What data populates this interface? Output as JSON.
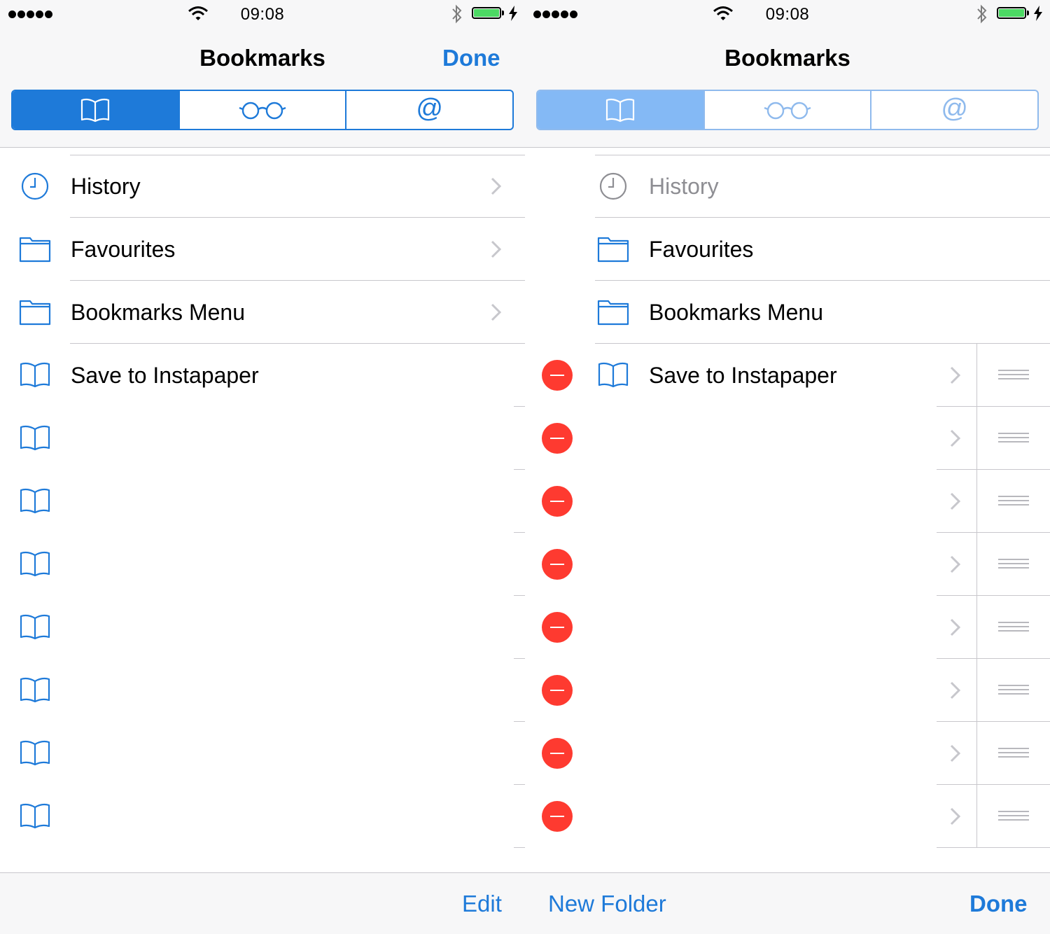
{
  "colors": {
    "accent": "#1e7ad9",
    "delete": "#fe3a30",
    "battery": "#4cd964",
    "separator": "#c8c7cc"
  },
  "left": {
    "status": {
      "time": "09:08"
    },
    "nav": {
      "title": "Bookmarks",
      "done_label": "Done"
    },
    "segments": [
      {
        "icon": "book-icon",
        "selected": true
      },
      {
        "icon": "glasses-icon",
        "selected": false
      },
      {
        "icon": "at-icon",
        "text": "@",
        "selected": false
      }
    ],
    "rows": [
      {
        "icon": "clock-icon",
        "label": "History",
        "chevron": true
      },
      {
        "icon": "folder-icon",
        "label": "Favourites",
        "chevron": true
      },
      {
        "icon": "folder-icon",
        "label": "Bookmarks Menu",
        "chevron": true
      },
      {
        "icon": "book-icon",
        "label": "Save to Instapaper",
        "chevron": false
      },
      {
        "icon": "book-icon",
        "label": "",
        "chevron": false
      },
      {
        "icon": "book-icon",
        "label": "",
        "chevron": false
      },
      {
        "icon": "book-icon",
        "label": "",
        "chevron": false
      },
      {
        "icon": "book-icon",
        "label": "",
        "chevron": false
      },
      {
        "icon": "book-icon",
        "label": "",
        "chevron": false
      },
      {
        "icon": "book-icon",
        "label": "",
        "chevron": false
      },
      {
        "icon": "book-icon",
        "label": "",
        "chevron": false
      }
    ],
    "toolbar": {
      "edit_label": "Edit"
    }
  },
  "right": {
    "status": {
      "time": "09:08"
    },
    "nav": {
      "title": "Bookmarks"
    },
    "segments": [
      {
        "icon": "book-icon",
        "selected": true
      },
      {
        "icon": "glasses-icon",
        "selected": false
      },
      {
        "icon": "at-icon",
        "text": "@",
        "selected": false
      }
    ],
    "rows": [
      {
        "icon": "clock-icon",
        "label": "History",
        "editable": false,
        "dimmed": true
      },
      {
        "icon": "folder-icon",
        "label": "Favourites",
        "editable": false
      },
      {
        "icon": "folder-icon",
        "label": "Bookmarks Menu",
        "editable": false
      },
      {
        "icon": "book-icon",
        "label": "Save to Instapaper",
        "editable": true
      },
      {
        "icon": "",
        "label": "",
        "editable": true
      },
      {
        "icon": "",
        "label": "",
        "editable": true
      },
      {
        "icon": "",
        "label": "",
        "editable": true
      },
      {
        "icon": "",
        "label": "",
        "editable": true
      },
      {
        "icon": "",
        "label": "",
        "editable": true
      },
      {
        "icon": "",
        "label": "",
        "editable": true
      },
      {
        "icon": "",
        "label": "",
        "editable": true
      }
    ],
    "toolbar": {
      "new_folder_label": "New Folder",
      "done_label": "Done"
    }
  }
}
